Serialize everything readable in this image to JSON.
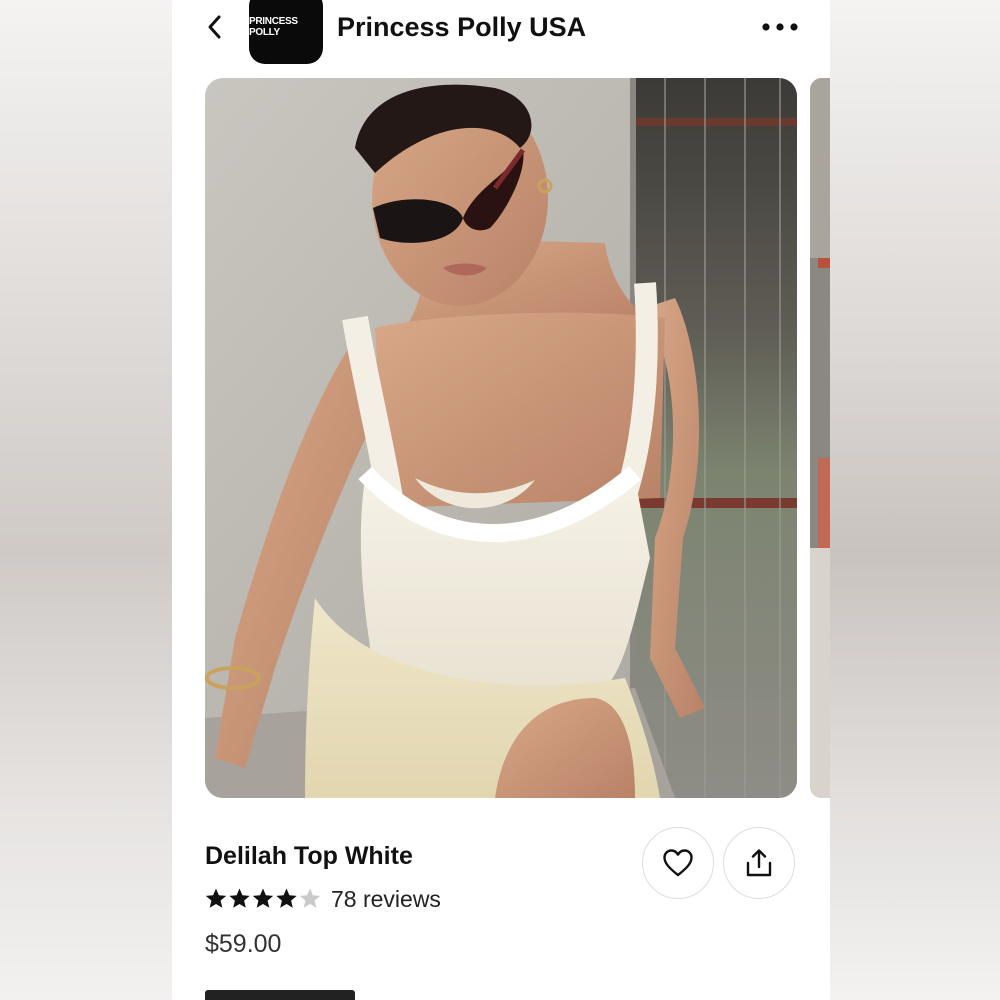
{
  "header": {
    "brand_logo_text": "PRINCESS POLLY",
    "brand_name": "Princess Polly USA",
    "back_icon": "chevron-left-icon",
    "more_icon": "more-horizontal-icon"
  },
  "product": {
    "title": "Delilah Top White",
    "rating": 4.5,
    "reviews": "78 reviews",
    "price": "$59.00",
    "favorite_icon": "heart-icon",
    "share_icon": "share-icon"
  },
  "colors": {
    "text": "#111111",
    "button_border": "#dcdcdc"
  }
}
